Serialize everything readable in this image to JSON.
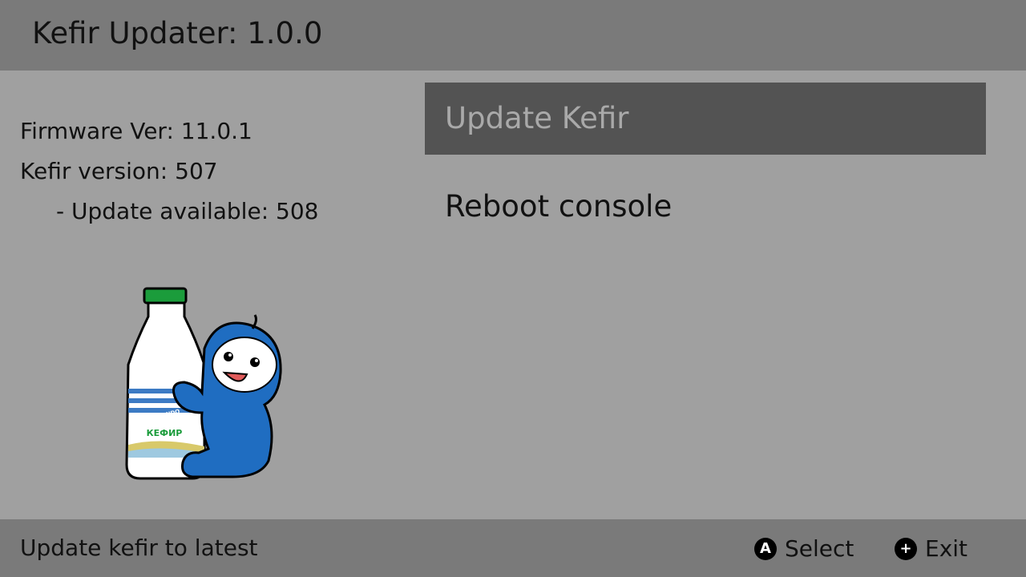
{
  "header": {
    "title": "Kefir Updater: 1.0.0"
  },
  "info": {
    "firmware": "Firmware Ver: 11.0.1",
    "kefir_version": "Kefir version: 507",
    "update_available": "- Update available: 508"
  },
  "menu": {
    "items": [
      {
        "label": "Update Kefir",
        "selected": true
      },
      {
        "label": "Reboot console",
        "selected": false
      }
    ]
  },
  "illustration": {
    "label_text": "КЕФИР",
    "brand_text": "CFW NINTENDO"
  },
  "footer": {
    "hint": "Update kefir to latest",
    "buttons": [
      {
        "glyph": "A",
        "label": "Select",
        "icon": "a-button-icon"
      },
      {
        "glyph": "+",
        "label": "Exit",
        "icon": "plus-button-icon"
      }
    ]
  },
  "colors": {
    "header_bg": "#7a7a7a",
    "body_bg": "#a0a0a0",
    "selected_bg": "#535353",
    "selected_text": "#a9a9a9"
  }
}
